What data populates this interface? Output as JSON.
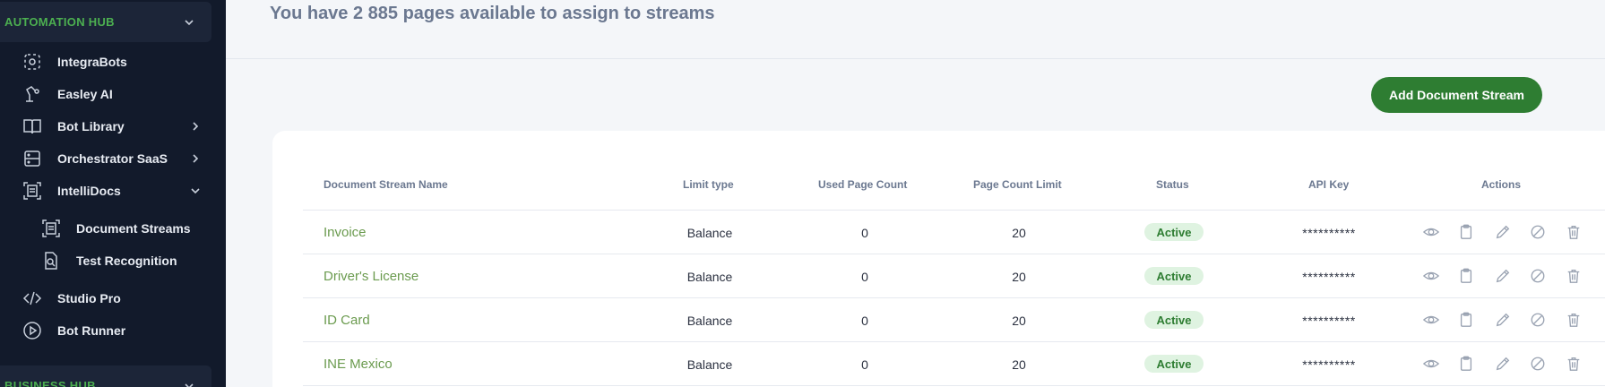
{
  "sidebar": {
    "automation_hub": "AUTOMATION HUB",
    "business_hub": "BUSINESS HUB",
    "items": [
      {
        "label": "IntegraBots",
        "icon": "integrabots-icon"
      },
      {
        "label": "Easley AI",
        "icon": "robot-arm-icon"
      },
      {
        "label": "Bot Library",
        "icon": "book-icon"
      },
      {
        "label": "Orchestrator SaaS",
        "icon": "server-icon"
      },
      {
        "label": "IntelliDocs",
        "icon": "document-scan-icon"
      },
      {
        "label": "Studio Pro",
        "icon": "code-icon"
      },
      {
        "label": "Bot Runner",
        "icon": "play-circle-icon"
      }
    ],
    "intellidocs_sub": [
      {
        "label": "Document Streams",
        "icon": "document-scan-icon"
      },
      {
        "label": "Test Recognition",
        "icon": "document-search-icon"
      }
    ]
  },
  "main": {
    "available_text": "You have 2 885 pages available to assign to streams",
    "add_button": "Add Document Stream"
  },
  "table": {
    "headers": [
      "Document Stream Name",
      "Limit type",
      "Used Page Count",
      "Page Count Limit",
      "Status",
      "API Key",
      "Actions"
    ],
    "rows": [
      {
        "name": "Invoice",
        "limit_type": "Balance",
        "used": "0",
        "limit": "20",
        "status": "Active",
        "api_key": "**********"
      },
      {
        "name": "Driver's License",
        "limit_type": "Balance",
        "used": "0",
        "limit": "20",
        "status": "Active",
        "api_key": "**********"
      },
      {
        "name": "ID Card",
        "limit_type": "Balance",
        "used": "0",
        "limit": "20",
        "status": "Active",
        "api_key": "**********"
      },
      {
        "name": "INE Mexico",
        "limit_type": "Balance",
        "used": "0",
        "limit": "20",
        "status": "Active",
        "api_key": "**********"
      }
    ],
    "actions": [
      "eye-icon",
      "clipboard-icon",
      "pencil-icon",
      "disable-icon",
      "trash-icon"
    ]
  },
  "colors": {
    "sidebar_bg": "#121a2b",
    "accent_green": "#4caf50",
    "button_green": "#2e7d32",
    "link_green": "#6b9b4f",
    "badge_bg": "#dff3e1"
  }
}
